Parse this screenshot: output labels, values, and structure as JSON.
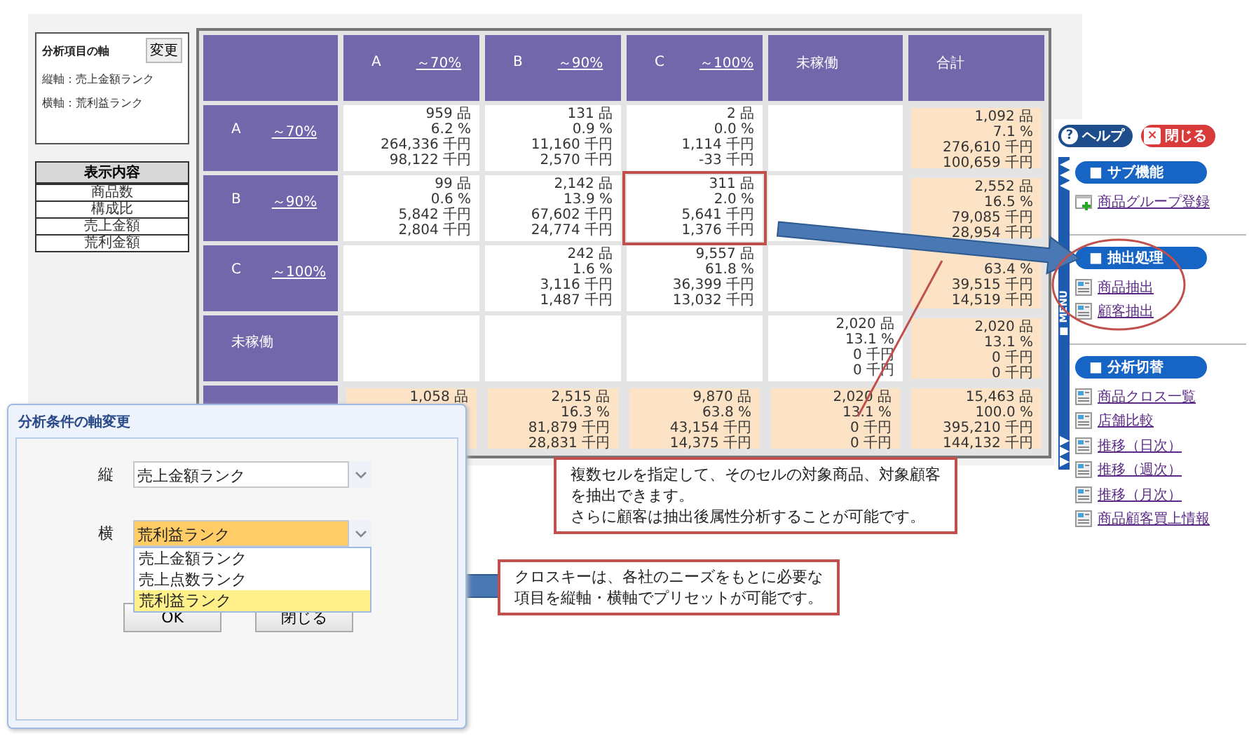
{
  "axis_panel": {
    "title": "分析項目の軸",
    "button": "変更",
    "rows": [
      "縦軸：売上金額ランク",
      "横軸：荒利益ランク"
    ]
  },
  "display_table": {
    "header": "表示内容",
    "rows": [
      "商品数",
      "構成比",
      "売上金額",
      "荒利金額"
    ]
  },
  "grid": {
    "columns": [
      {
        "label": "A",
        "link": "～70%"
      },
      {
        "label": "B",
        "link": "～90%"
      },
      {
        "label": "C",
        "link": "～100%"
      },
      {
        "label": "未稼働"
      },
      {
        "label": "合計"
      }
    ],
    "rows": [
      {
        "label": "A",
        "link": "～70%",
        "cells": [
          {
            "kind": "normal",
            "lines": [
              "959 品",
              "6.2 %",
              "264,336 千円",
              "98,122 千円"
            ]
          },
          {
            "kind": "normal",
            "lines": [
              "131 品",
              "0.9 %",
              "11,160 千円",
              "2,570 千円"
            ]
          },
          {
            "kind": "normal",
            "lines": [
              "2 品",
              "0.0 %",
              "1,114 千円",
              "-33 千円"
            ]
          },
          {
            "kind": "normal"
          },
          {
            "kind": "total",
            "lines": [
              "1,092 品",
              "7.1 %",
              "276,610 千円",
              "100,659 千円"
            ]
          }
        ]
      },
      {
        "label": "B",
        "link": "～90%",
        "cells": [
          {
            "kind": "normal",
            "lines": [
              "99 品",
              "0.6 %",
              "5,842 千円",
              "2,804 千円"
            ]
          },
          {
            "kind": "normal",
            "lines": [
              "2,142 品",
              "13.9 %",
              "67,602 千円",
              "24,774 千円"
            ]
          },
          {
            "kind": "marked",
            "lines": [
              "311 品",
              "2.0 %",
              "5,641 千円",
              "1,376 千円"
            ]
          },
          {
            "kind": "normal"
          },
          {
            "kind": "total",
            "lines": [
              "2,552 品",
              "16.5 %",
              "79,085 千円",
              "28,954 千円"
            ]
          }
        ]
      },
      {
        "label": "C",
        "link": "～100%",
        "cells": [
          {
            "kind": "normal"
          },
          {
            "kind": "normal",
            "lines": [
              "242 品",
              "1.6 %",
              "3,116 千円",
              "1,487 千円"
            ]
          },
          {
            "kind": "normal",
            "lines": [
              "9,557 品",
              "61.8 %",
              "36,399 千円",
              "13,032 千円"
            ]
          },
          {
            "kind": "normal"
          },
          {
            "kind": "total",
            "bottom": true,
            "lines": [
              "63.4 %",
              "39,515 千円",
              "14,519 千円"
            ]
          }
        ]
      },
      {
        "label": "未稼働",
        "cells": [
          {
            "kind": "normal"
          },
          {
            "kind": "normal"
          },
          {
            "kind": "normal"
          },
          {
            "kind": "normal",
            "lines": [
              "2,020 品",
              "13.1 %",
              "0 千円",
              "0 千円"
            ]
          },
          {
            "kind": "total",
            "lines": [
              "2,020 品",
              "13.1 %",
              "0 千円",
              "0 千円"
            ]
          }
        ]
      },
      {
        "cells": [
          {
            "kind": "total",
            "lines": [
              "1,058 品"
            ]
          },
          {
            "kind": "total",
            "lines": [
              "2,515 品",
              "16.3 %",
              "81,879 千円",
              "28,831 千円"
            ]
          },
          {
            "kind": "total",
            "lines": [
              "9,870 品",
              "63.8 %",
              "43,154 千円",
              "14,375 千円"
            ]
          },
          {
            "kind": "total",
            "lines": [
              "2,020 品",
              "13.1 %",
              "0 千円",
              "0 千円"
            ]
          },
          {
            "kind": "total",
            "lines": [
              "15,463 品",
              "100.0 %",
              "395,210 千円",
              "144,132 千円"
            ]
          }
        ]
      }
    ]
  },
  "sidebar": {
    "help_button": {
      "icon": "?",
      "label": "ヘルプ"
    },
    "close_button": {
      "icon": "×",
      "label": "閉じる"
    },
    "menu_label": "■ MENU",
    "sections": [
      {
        "title": "■ サブ機能",
        "items": [
          {
            "label": "商品グループ登録",
            "kind": "add"
          }
        ]
      },
      {
        "title": "■ 抽出処理",
        "items": [
          {
            "label": "商品抽出",
            "kind": "page"
          },
          {
            "label": "顧客抽出",
            "kind": "page"
          }
        ]
      },
      {
        "title": "■ 分析切替",
        "items": [
          {
            "label": "商品クロス一覧",
            "kind": "page"
          },
          {
            "label": "店舗比較",
            "kind": "page"
          },
          {
            "label": "推移（日次）",
            "kind": "page"
          },
          {
            "label": "推移（週次）",
            "kind": "page"
          },
          {
            "label": "推移（月次）",
            "kind": "page"
          },
          {
            "label": "商品顧客買上情報",
            "kind": "page"
          }
        ]
      }
    ]
  },
  "dialog": {
    "title": "分析条件の軸変更",
    "fields": [
      {
        "label": "縦",
        "value": "売上金額ランク",
        "focused": false
      },
      {
        "label": "横",
        "value": "荒利益ランク",
        "focused": true
      }
    ],
    "options": [
      {
        "label": "売上金額ランク",
        "selected": false
      },
      {
        "label": "売上点数ランク",
        "selected": false
      },
      {
        "label": "荒利益ランク",
        "selected": true
      }
    ],
    "buttons": [
      "OK",
      "閉じる"
    ]
  },
  "callouts": [
    {
      "lines": [
        "複数セルを指定して、そのセルの対象商品、対象顧客",
        "を抽出できます。",
        "さらに顧客は抽出後属性分析することが可能です。"
      ]
    },
    {
      "lines": [
        "クロスキーは、各社のニーズをもとに必要な",
        "項目を縦軸・横軸でプリセットが可能です。"
      ]
    }
  ]
}
